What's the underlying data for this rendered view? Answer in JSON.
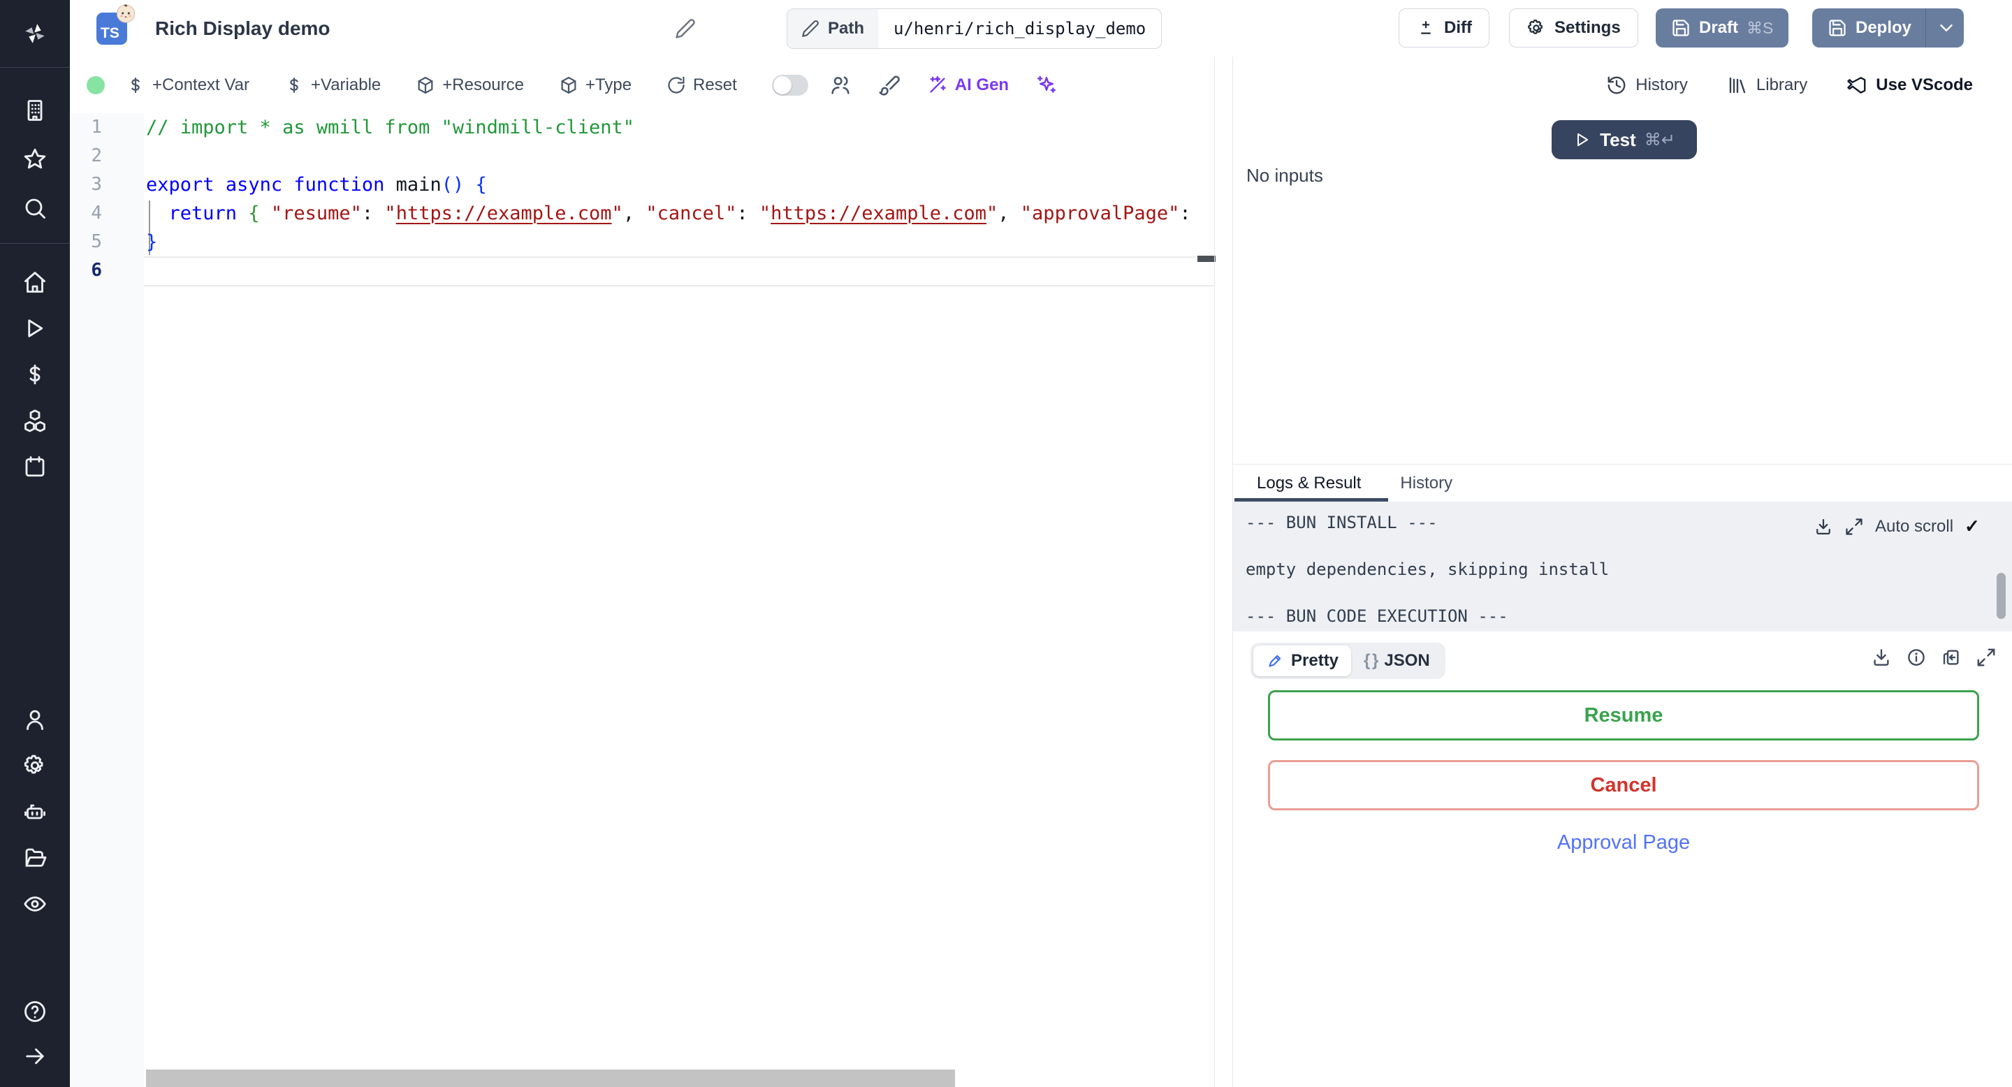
{
  "header": {
    "badge": "TS",
    "title": "Rich Display demo",
    "path_label": "Path",
    "path_value": "u/henri/rich_display_demo",
    "diff_label": "Diff",
    "settings_label": "Settings",
    "draft_label": "Draft",
    "draft_shortcut": "⌘S",
    "deploy_label": "Deploy"
  },
  "toolbar": {
    "context_var": "+Context Var",
    "variable": "+Variable",
    "resource": "+Resource",
    "type": "+Type",
    "reset": "Reset",
    "ai_gen": "AI Gen",
    "history": "History",
    "library": "Library",
    "use_vscode": "Use VScode"
  },
  "editor": {
    "active_line": 6,
    "line_numbers": [
      "1",
      "2",
      "3",
      "4",
      "5",
      "6"
    ],
    "lines": [
      [
        {
          "t": "// import * as wmill from \"windmill-client\"",
          "c": "cm"
        }
      ],
      [],
      [
        {
          "t": "export",
          "c": "kw"
        },
        {
          "t": " ",
          "c": "pl"
        },
        {
          "t": "async",
          "c": "kw"
        },
        {
          "t": " ",
          "c": "pl"
        },
        {
          "t": "function",
          "c": "kw"
        },
        {
          "t": " ",
          "c": "pl"
        },
        {
          "t": "main",
          "c": "fn"
        },
        {
          "t": "() {",
          "c": "br1"
        }
      ],
      [
        {
          "t": "  ",
          "c": "pl"
        },
        {
          "t": "return",
          "c": "kw"
        },
        {
          "t": " ",
          "c": "pl"
        },
        {
          "t": "{",
          "c": "br2"
        },
        {
          "t": " ",
          "c": "pl"
        },
        {
          "t": "\"resume\"",
          "c": "str"
        },
        {
          "t": ": ",
          "c": "pl"
        },
        {
          "t": "\"",
          "c": "str"
        },
        {
          "t": "https://example.com",
          "c": "lnk"
        },
        {
          "t": "\"",
          "c": "str"
        },
        {
          "t": ", ",
          "c": "pl"
        },
        {
          "t": "\"cancel\"",
          "c": "str"
        },
        {
          "t": ": ",
          "c": "pl"
        },
        {
          "t": "\"",
          "c": "str"
        },
        {
          "t": "https://example.com",
          "c": "lnk"
        },
        {
          "t": "\"",
          "c": "str"
        },
        {
          "t": ", ",
          "c": "pl"
        },
        {
          "t": "\"approvalPage\"",
          "c": "str"
        },
        {
          "t": ":",
          "c": "pl"
        }
      ],
      [
        {
          "t": "}",
          "c": "br1"
        }
      ],
      []
    ]
  },
  "runner": {
    "test_label": "Test",
    "test_shortcut": "⌘↵",
    "no_inputs": "No inputs"
  },
  "logs": {
    "tab_logs": "Logs & Result",
    "tab_history": "History",
    "auto_scroll": "Auto scroll",
    "check": "✓",
    "lines": [
      "--- BUN INSTALL ---",
      "empty dependencies, skipping install",
      "--- BUN CODE EXECUTION ---"
    ]
  },
  "result": {
    "pretty_label": "Pretty",
    "json_braces": "{ }",
    "json_label": "JSON",
    "resume_label": "Resume",
    "cancel_label": "Cancel",
    "approval_label": "Approval Page"
  },
  "colors": {
    "slate_button": "#697d9f",
    "dark_button": "#37445f",
    "ai_purple": "#7c3aed",
    "resume_green": "#3aa24e",
    "cancel_red": "#d0342c",
    "link_blue": "#5272f7",
    "status_green": "#86e3a2"
  }
}
